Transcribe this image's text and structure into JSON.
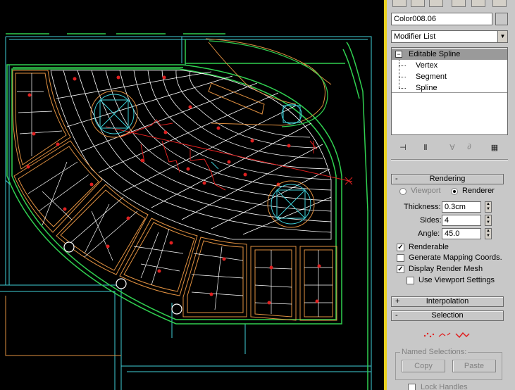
{
  "viewport": {
    "background": "#000000"
  },
  "panel": {
    "name_value": "Color008.06",
    "modifier_list": "Modifier List",
    "stack": {
      "root": "Editable Spline",
      "children": [
        "Vertex",
        "Segment",
        "Spline"
      ]
    },
    "tool_icons": [
      "pin-stack-icon",
      "show-end-result-icon",
      "make-unique-icon",
      "remove-modifier-icon",
      "configure-modifier-sets-icon"
    ],
    "rendering": {
      "header": "Rendering",
      "toggle": "-",
      "radio_viewport": "Viewport",
      "radio_renderer": "Renderer",
      "thickness_label": "Thickness:",
      "thickness_value": "0.3cm",
      "sides_label": "Sides:",
      "sides_value": "4",
      "angle_label": "Angle:",
      "angle_value": "45.0",
      "renderable": "Renderable",
      "gen_mapping": "Generate Mapping Coords.",
      "display_mesh": "Display Render Mesh",
      "use_viewport": "Use Viewport Settings"
    },
    "interpolation": {
      "header": "Interpolation",
      "toggle": "+"
    },
    "selection": {
      "header": "Selection",
      "toggle": "-",
      "named_selections": "Named Selections:",
      "copy": "Copy",
      "paste": "Paste",
      "lock_handles": "Lock Handles"
    }
  },
  "colors": {
    "highlight_border": "#e8d020",
    "panel_bg": "#c8c8c8",
    "cyan_lines": "#3fd0d8",
    "green_lines": "#30d050",
    "orange_lines": "#e09040",
    "white_grid": "#ffffff",
    "red_spline": "#e02020"
  }
}
